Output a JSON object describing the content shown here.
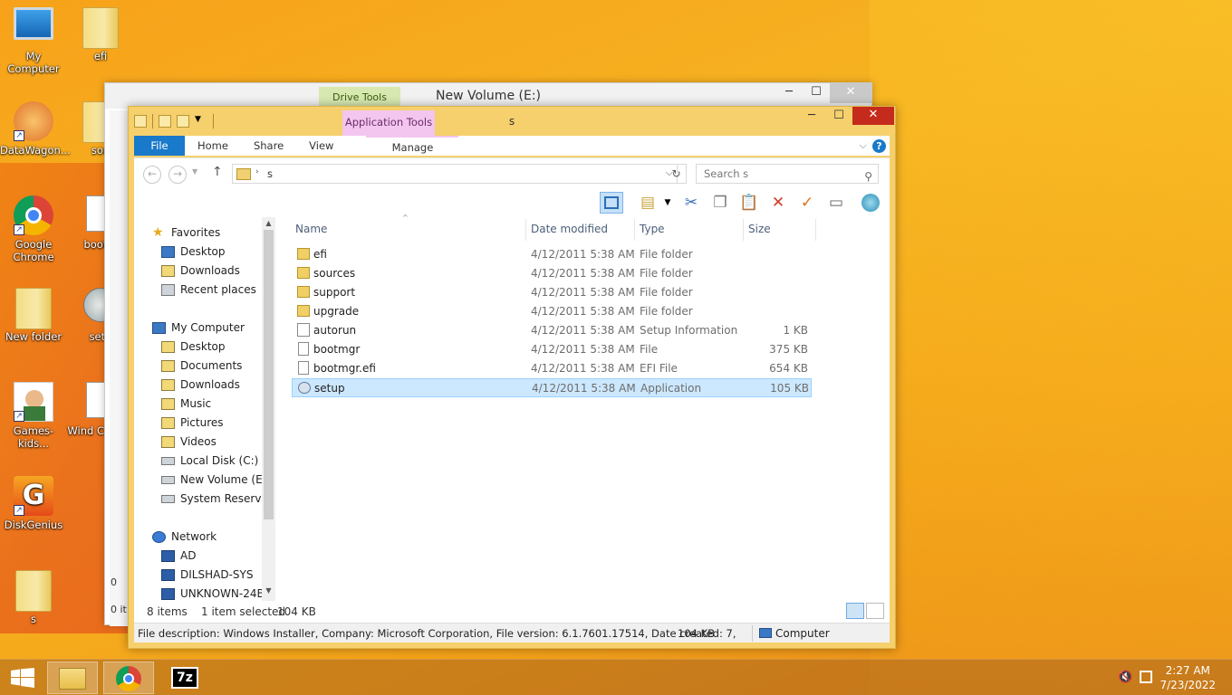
{
  "desktop": {
    "icons": [
      {
        "label": "My Computer",
        "kind": "pc"
      },
      {
        "label": "efi",
        "kind": "folder"
      },
      {
        "label": "DataWagon...",
        "kind": "app"
      },
      {
        "label": "sou",
        "kind": "folder"
      },
      {
        "label": "Google Chrome",
        "kind": "chrome"
      },
      {
        "label": "bootm",
        "kind": "file"
      },
      {
        "label": "New folder",
        "kind": "folder"
      },
      {
        "label": "setu",
        "kind": "app"
      },
      {
        "label": "Games-kids...",
        "kind": "app"
      },
      {
        "label": "Wind Compa",
        "kind": "file"
      },
      {
        "label": "DiskGenius",
        "kind": "app"
      },
      {
        "label": "s",
        "kind": "folder"
      }
    ]
  },
  "back_window": {
    "title": "New Volume (E:)",
    "context_tab": "Drive Tools",
    "status_fragments": [
      "0",
      "0 it"
    ]
  },
  "window": {
    "title": "s",
    "context_tab": "Application Tools",
    "tabs": {
      "file": "File",
      "home": "Home",
      "share": "Share",
      "view": "View",
      "manage": "Manage"
    },
    "address": {
      "path": "s"
    },
    "search": {
      "placeholder": "Search s"
    },
    "nav": {
      "favorites": "Favorites",
      "fav_items": [
        "Desktop",
        "Downloads",
        "Recent places"
      ],
      "computer": "My Computer",
      "computer_items": [
        "Desktop",
        "Documents",
        "Downloads",
        "Music",
        "Pictures",
        "Videos",
        "Local Disk (C:)",
        "New Volume (E:)",
        "System Reserved"
      ],
      "network": "Network",
      "network_items": [
        "AD",
        "DILSHAD-SYS",
        "UNKNOWN-24BE"
      ]
    },
    "columns": {
      "name": "Name",
      "date": "Date modified",
      "type": "Type",
      "size": "Size"
    },
    "files": [
      {
        "name": "efi",
        "date": "4/12/2011 5:38 AM",
        "type": "File folder",
        "size": "",
        "icon": "folder"
      },
      {
        "name": "sources",
        "date": "4/12/2011 5:38 AM",
        "type": "File folder",
        "size": "",
        "icon": "folder"
      },
      {
        "name": "support",
        "date": "4/12/2011 5:38 AM",
        "type": "File folder",
        "size": "",
        "icon": "folder"
      },
      {
        "name": "upgrade",
        "date": "4/12/2011 5:38 AM",
        "type": "File folder",
        "size": "",
        "icon": "folder"
      },
      {
        "name": "autorun",
        "date": "4/12/2011 5:38 AM",
        "type": "Setup Information",
        "size": "1 KB",
        "icon": "setup-info"
      },
      {
        "name": "bootmgr",
        "date": "4/12/2011 5:38 AM",
        "type": "File",
        "size": "375 KB",
        "icon": "file"
      },
      {
        "name": "bootmgr.efi",
        "date": "4/12/2011 5:38 AM",
        "type": "EFI File",
        "size": "654 KB",
        "icon": "file"
      },
      {
        "name": "setup",
        "date": "4/12/2011 5:38 AM",
        "type": "Application",
        "size": "105 KB",
        "icon": "application",
        "selected": true
      }
    ],
    "status": {
      "items": "8 items",
      "selected": "1 item selected",
      "selected_size": "104 KB"
    },
    "details": {
      "description": "File description: Windows Installer, Company: Microsoft Corporation, File version: 6.1.7601.17514, Date created: 7,",
      "size": "104 KB",
      "location": "Computer"
    }
  },
  "taskbar": {
    "time": "2:27 AM",
    "date": "7/23/2022",
    "apps": [
      "file-explorer",
      "chrome",
      "7-zip"
    ],
    "seven_zip_label": "7z"
  }
}
